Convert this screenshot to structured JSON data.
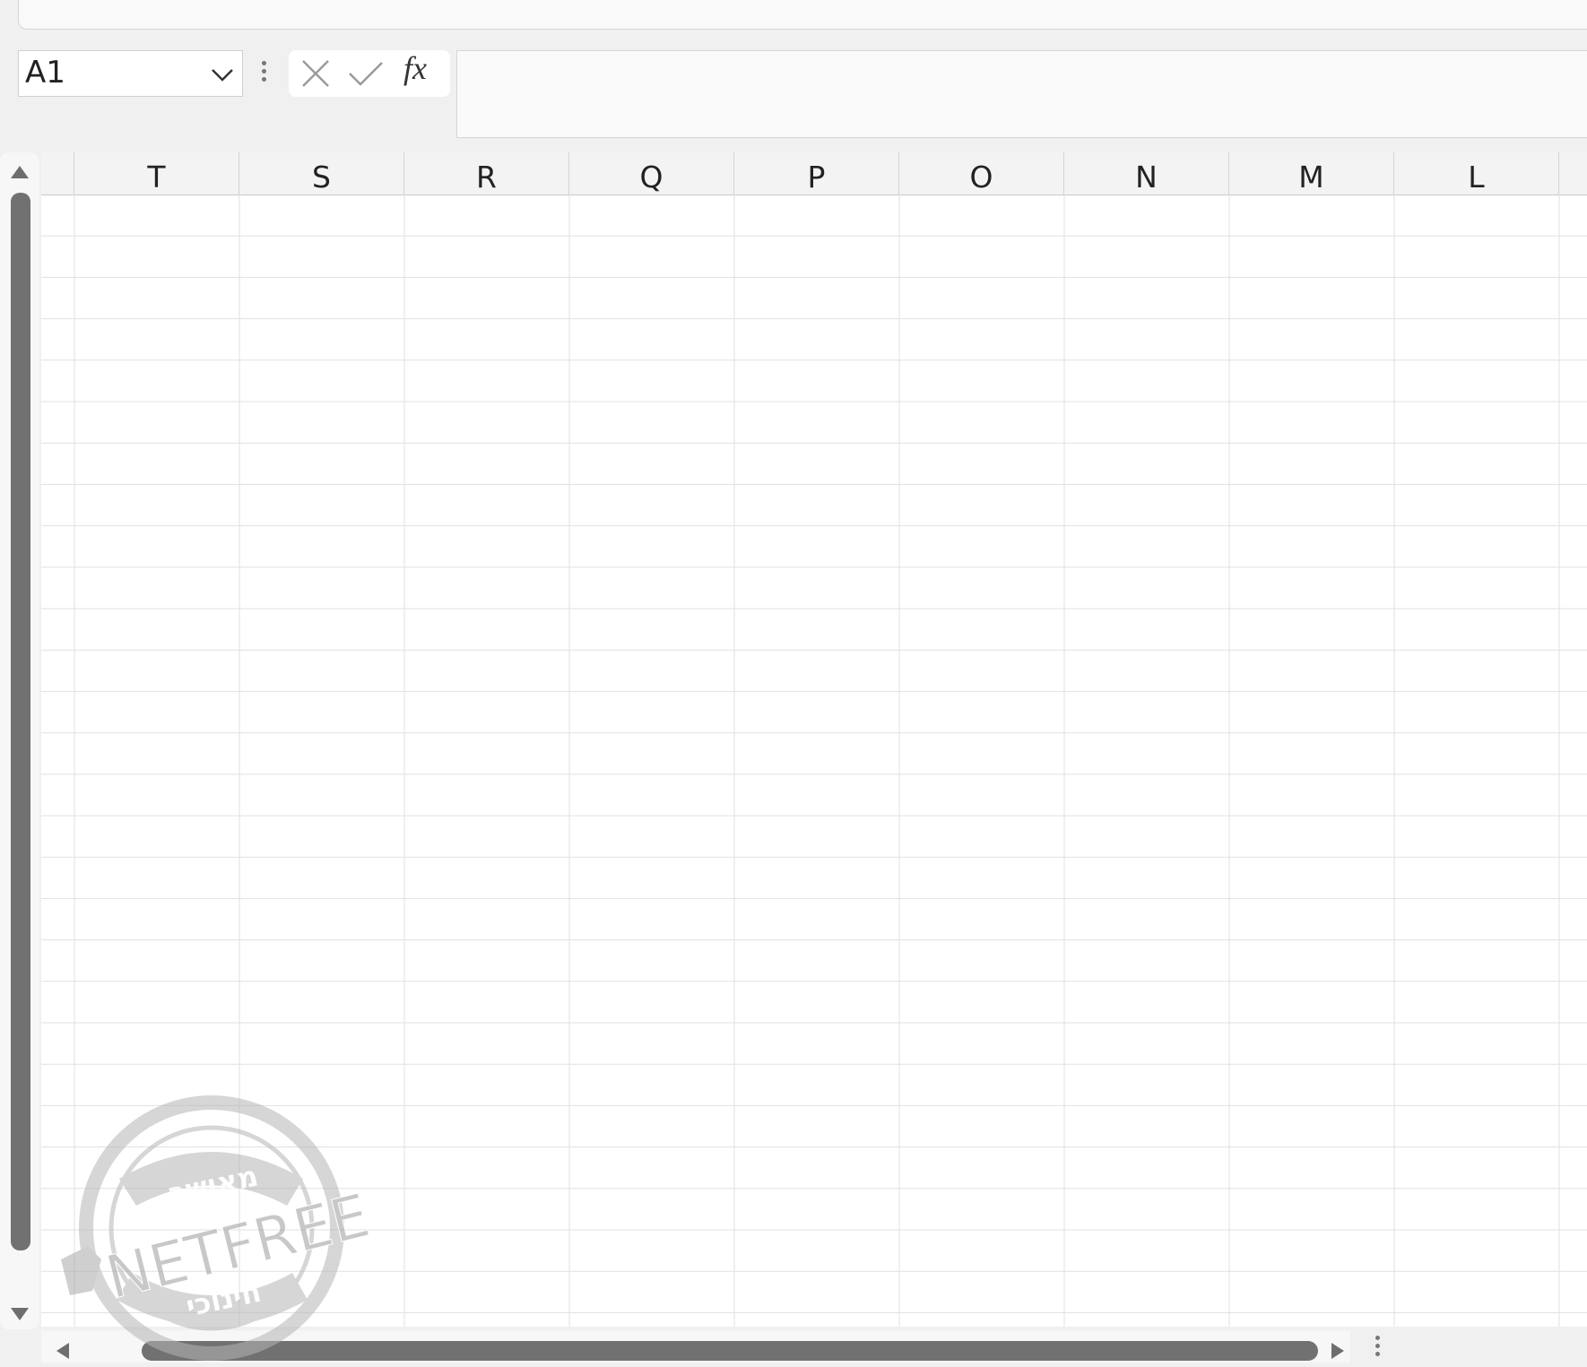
{
  "formula_bar": {
    "name_box_value": "A1",
    "fx_label": "fx",
    "formula_value": ""
  },
  "columns": [
    "T",
    "S",
    "R",
    "Q",
    "P",
    "O",
    "N",
    "M",
    "L"
  ],
  "watermark": {
    "brand": "NETFREE",
    "top_text": "מאושר",
    "bottom_text": "חינוכי"
  },
  "icons": {
    "cancel": "close-icon",
    "enter": "check-icon",
    "name_box_dropdown": "chevron-down-icon"
  },
  "colors": {
    "scroll_thumb": "#717171",
    "grid_line": "#e1e1e1",
    "header_bg": "#f3f3f3"
  }
}
